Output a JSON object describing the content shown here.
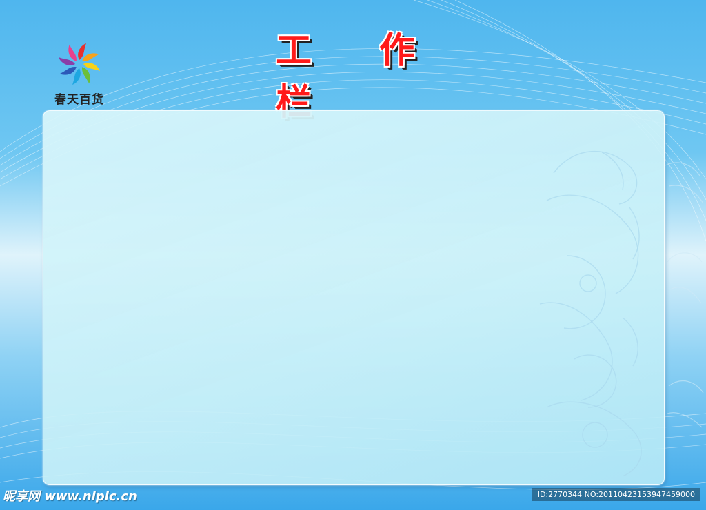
{
  "logo": {
    "brand_text": "春天百货",
    "icon": "flower-logo-icon"
  },
  "title": "工 作 栏",
  "board": {
    "state": "empty"
  },
  "watermark": {
    "site": "昵享网 www.nipic.cn",
    "id_text": "ID:2770344 NO:20110423153947459000"
  },
  "colors": {
    "title": "#ff1a1a",
    "background": "#4fb6ee",
    "board": "#d7f5fa"
  }
}
